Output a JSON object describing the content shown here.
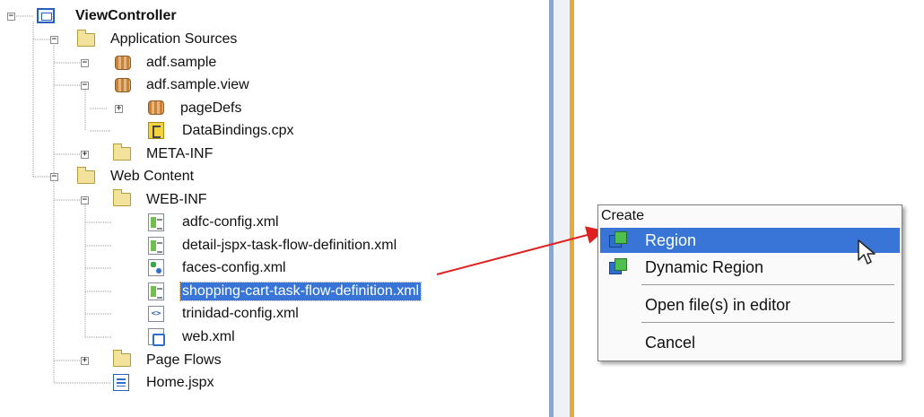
{
  "tree": {
    "items": [
      {
        "label": "ViewController",
        "icon": "project-icon",
        "expander": "-",
        "bold": true
      },
      {
        "label": "Application Sources",
        "icon": "folder-icon",
        "expander": "-"
      },
      {
        "label": "adf.sample",
        "icon": "package-icon",
        "expander": "-"
      },
      {
        "label": "adf.sample.view",
        "icon": "package-icon",
        "expander": "-"
      },
      {
        "label": "pageDefs",
        "icon": "package-icon",
        "expander": "+"
      },
      {
        "label": "DataBindings.cpx",
        "icon": "cpx-file-icon"
      },
      {
        "label": "META-INF",
        "icon": "folder-icon",
        "expander": "+"
      },
      {
        "label": "Web Content",
        "icon": "folder-icon",
        "expander": "-"
      },
      {
        "label": "WEB-INF",
        "icon": "folder-icon",
        "expander": "-"
      },
      {
        "label": "adfc-config.xml",
        "icon": "task-flow-file-icon"
      },
      {
        "label": "detail-jspx-task-flow-definition.xml",
        "icon": "task-flow-file-icon"
      },
      {
        "label": "faces-config.xml",
        "icon": "faces-config-file-icon"
      },
      {
        "label": "shopping-cart-task-flow-definition.xml",
        "icon": "task-flow-file-icon",
        "selected": true
      },
      {
        "label": "trinidad-config.xml",
        "icon": "xml-file-icon"
      },
      {
        "label": "web.xml",
        "icon": "web-xml-file-icon"
      },
      {
        "label": "Page Flows",
        "icon": "folder-icon",
        "expander": "+"
      },
      {
        "label": "Home.jspx",
        "icon": "jspx-file-icon"
      }
    ]
  },
  "context_menu": {
    "header": "Create",
    "items": [
      {
        "label": "Region",
        "icon": "region-icon",
        "highlighted": true
      },
      {
        "label": "Dynamic Region",
        "icon": "region-icon"
      },
      {
        "label": "Open file(s) in editor"
      },
      {
        "label": "Cancel"
      }
    ]
  },
  "colors": {
    "selection": "#3875d7",
    "arrow": "#e02020",
    "splitter_accent": "#e9a93a"
  }
}
